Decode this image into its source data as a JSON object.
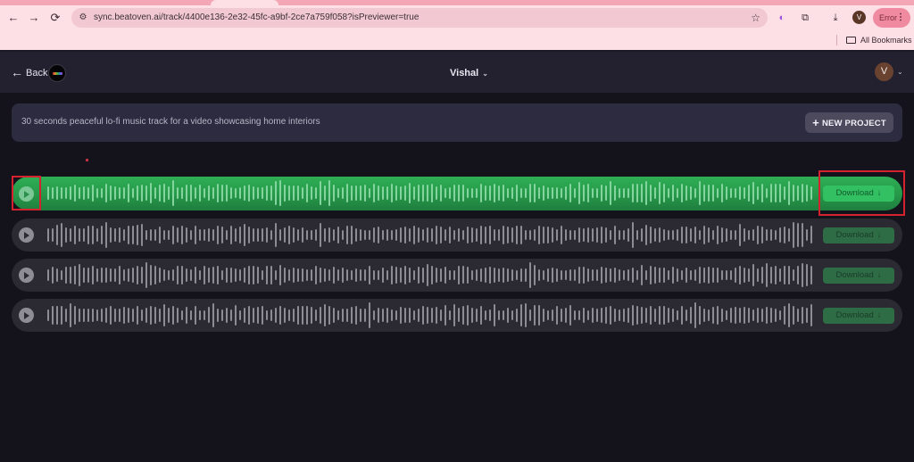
{
  "browser": {
    "url": "sync.beatoven.ai/track/4400e136-2e32-45fc-a9bf-2ce7a759f058?isPreviewer=true",
    "profile_initial": "V",
    "error_label": "Error",
    "bookmarks_label": "All Bookmarks",
    "icons": {
      "back": "←",
      "forward": "→",
      "reload": "⟳",
      "site_settings": "⚙",
      "star": "☆",
      "extensions": "⧉",
      "download": "⤓",
      "menu": "⋮"
    }
  },
  "header": {
    "back_label": "Back",
    "back_arrow": "←",
    "project_name": "Vishal",
    "chevron": "⌄",
    "avatar_initial": "V"
  },
  "prompt": {
    "text": "30 seconds peaceful lo-fi music track for a video showcasing home interiors",
    "new_project_plus": "+",
    "new_project_label": "NEW PROJECT"
  },
  "tracks": [
    {
      "active": true,
      "download_label": "Download",
      "download_icon": "↓"
    },
    {
      "active": false,
      "download_label": "Download",
      "download_icon": "↓"
    },
    {
      "active": false,
      "download_label": "Download",
      "download_icon": "↓"
    },
    {
      "active": false,
      "download_label": "Download",
      "download_icon": "↓"
    }
  ],
  "colors": {
    "active_track": "#2fae55",
    "download_active": "#32c062",
    "download_inactive": "#2e6c46",
    "annotation": "#d4232f"
  }
}
